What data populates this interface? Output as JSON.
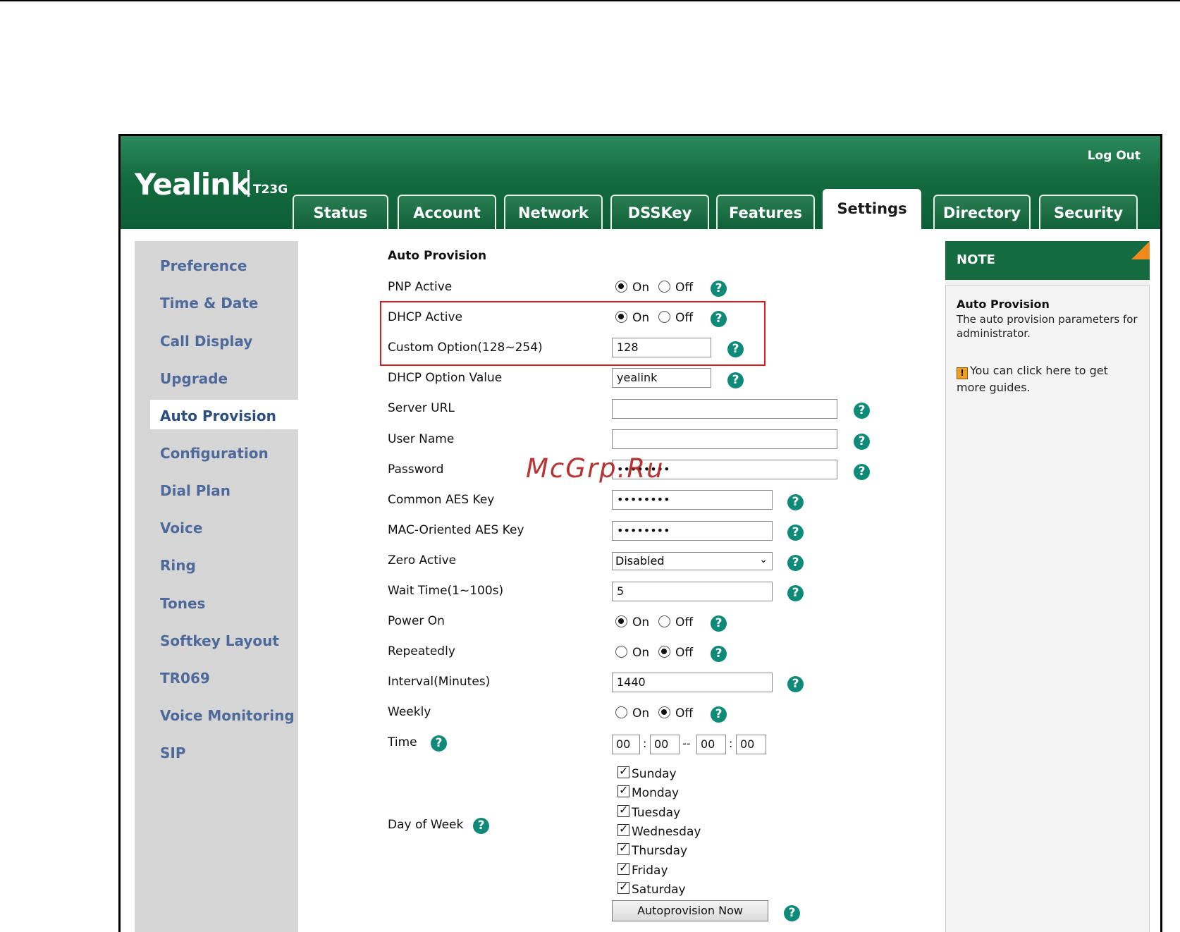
{
  "header": {
    "logo": "Yealink",
    "model": "T23G",
    "logout": "Log Out",
    "tabs": [
      "Status",
      "Account",
      "Network",
      "DSSKey",
      "Features",
      "Settings",
      "Directory",
      "Security"
    ],
    "active_tab": "Settings"
  },
  "sidebar": {
    "items": [
      "Preference",
      "Time & Date",
      "Call Display",
      "Upgrade",
      "Auto Provision",
      "Configuration",
      "Dial Plan",
      "Voice",
      "Ring",
      "Tones",
      "Softkey Layout",
      "TR069",
      "Voice Monitoring",
      "SIP"
    ],
    "active": "Auto Provision"
  },
  "form": {
    "section_title": "Auto Provision",
    "on_label": "On",
    "off_label": "Off",
    "help_glyph": "?",
    "pnp_active": {
      "label": "PNP Active",
      "value": "On"
    },
    "dhcp_active": {
      "label": "DHCP Active",
      "value": "On"
    },
    "custom_option": {
      "label": "Custom Option(128~254)",
      "value": "128"
    },
    "dhcp_option_value": {
      "label": "DHCP Option Value",
      "value": "yealink"
    },
    "server_url": {
      "label": "Server URL",
      "value": ""
    },
    "user_name": {
      "label": "User Name",
      "value": ""
    },
    "password": {
      "label": "Password",
      "value": "••••••••"
    },
    "common_aes_key": {
      "label": "Common AES Key",
      "value": "••••••••"
    },
    "mac_aes_key": {
      "label": "MAC-Oriented AES Key",
      "value": "••••••••"
    },
    "zero_active": {
      "label": "Zero Active",
      "value": "Disabled"
    },
    "wait_time": {
      "label": "Wait Time(1~100s)",
      "value": "5"
    },
    "power_on": {
      "label": "Power On",
      "value": "On"
    },
    "repeatedly": {
      "label": "Repeatedly",
      "value": "Off"
    },
    "interval": {
      "label": "Interval(Minutes)",
      "value": "1440"
    },
    "weekly": {
      "label": "Weekly",
      "value": "Off"
    },
    "time": {
      "label": "Time",
      "start_hour": "00",
      "start_minute": "00",
      "end_hour": "00",
      "end_minute": "00",
      "colon": ":",
      "dash": "--"
    },
    "day_of_week": {
      "label": "Day of Week",
      "days": [
        "Sunday",
        "Monday",
        "Tuesday",
        "Wednesday",
        "Thursday",
        "Friday",
        "Saturday"
      ]
    },
    "autoprovision_button": "Autoprovision Now"
  },
  "note": {
    "title": "NOTE",
    "heading": "Auto Provision",
    "text": "The auto provision parameters for administrator.",
    "link_icon": "!",
    "link_text": "You can click here to get more guides."
  },
  "watermark": "McGrp.Ru",
  "colors": {
    "header_green": "#136b3f",
    "sidebar_link": "#4e6a9a",
    "help_icon": "#0e8a78",
    "highlight_box": "#e0191c",
    "note_corner": "#f08a1f"
  }
}
